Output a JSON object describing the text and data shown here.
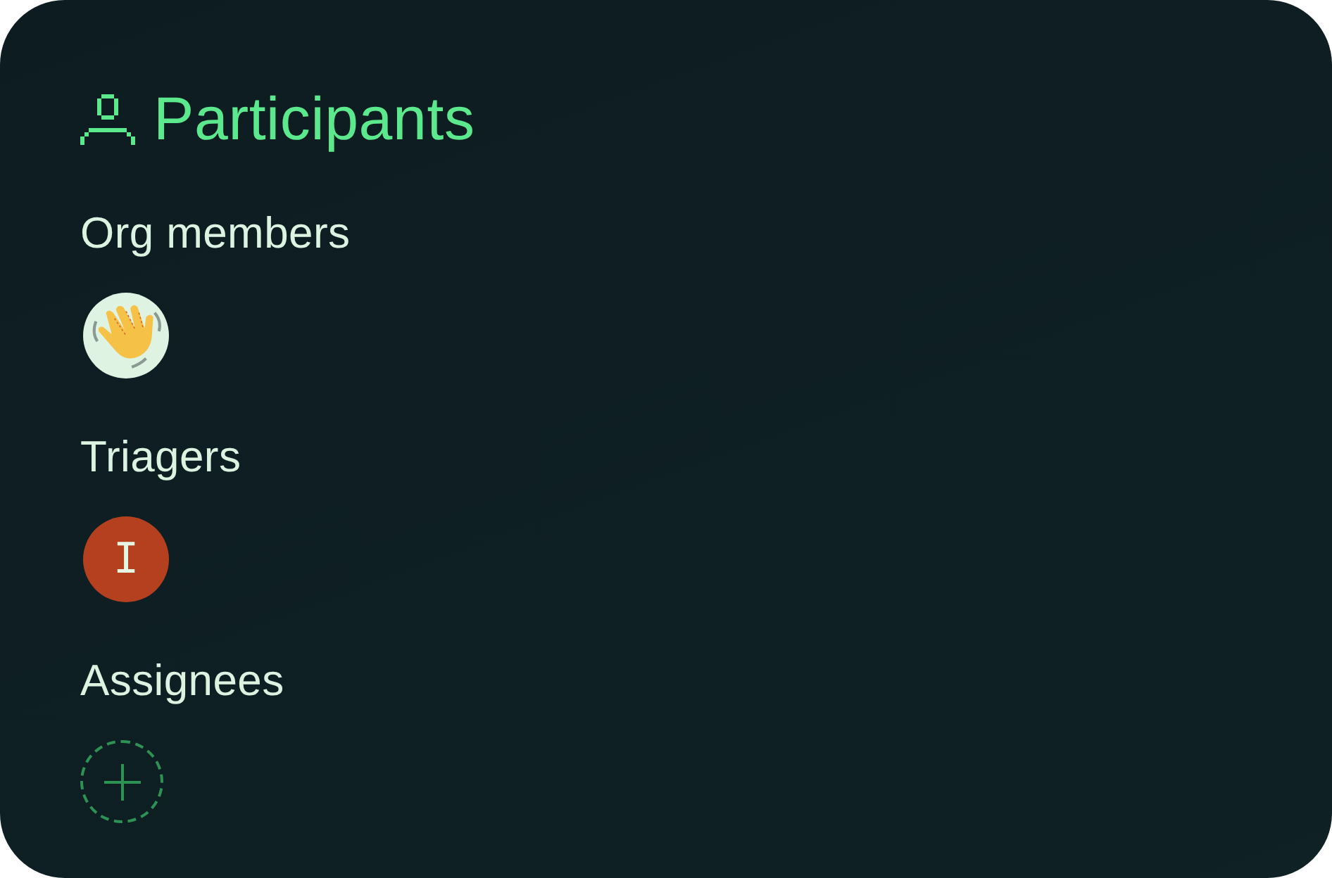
{
  "header": {
    "title": "Participants"
  },
  "groups": [
    {
      "label": "Org members",
      "items": [
        {
          "kind": "emoji"
        }
      ]
    },
    {
      "label": "Triagers",
      "items": [
        {
          "kind": "initial",
          "initial": "I"
        }
      ]
    },
    {
      "label": "Assignees",
      "items": [
        {
          "kind": "add"
        }
      ]
    }
  ]
}
